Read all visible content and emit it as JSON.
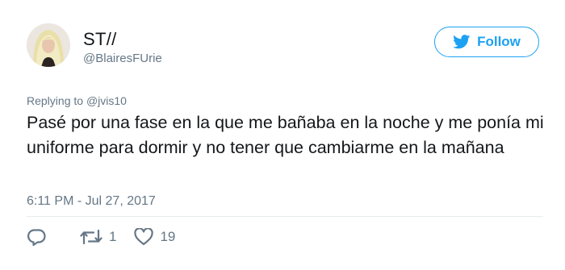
{
  "user": {
    "display_name": "ST//",
    "handle": "@BlairesFUrie",
    "avatar_icon": "avatar-photo"
  },
  "follow_button": {
    "label": "Follow",
    "icon": "twitter-bird-icon",
    "color": "#1da1f2"
  },
  "reply_context": {
    "prefix": "Replying to",
    "mention": "@jvis10"
  },
  "tweet": {
    "text": "Pasé por una fase en la que me bañaba en la noche y me ponía mi uniforme para dormir y no tener que cambiarme en la mañana",
    "timestamp": "6:11 PM - Jul 27, 2017"
  },
  "actions": {
    "reply": {
      "icon": "reply-icon",
      "count": ""
    },
    "retweet": {
      "icon": "retweet-icon",
      "count": "1"
    },
    "like": {
      "icon": "heart-icon",
      "count": "19"
    }
  },
  "colors": {
    "text": "#14171a",
    "secondary": "#657786",
    "accent": "#1da1f2"
  }
}
